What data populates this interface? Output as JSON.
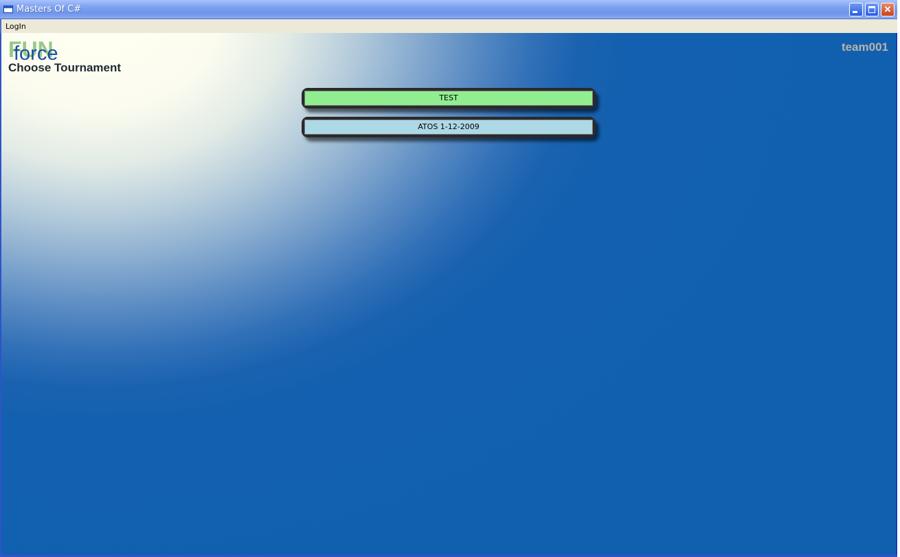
{
  "window": {
    "title": "Masters Of C#",
    "controls": {
      "minimize_icon": "minimize-icon",
      "maximize_icon": "maximize-icon",
      "close_icon": "close-icon",
      "close_glyph": "✕"
    }
  },
  "menu": {
    "items": [
      {
        "label": "LogIn"
      }
    ]
  },
  "header": {
    "logo": {
      "part1": "FUN",
      "part2": "force"
    },
    "page_title": "Choose Tournament",
    "team": "team001"
  },
  "tournaments": [
    {
      "label": "TEST",
      "color": "#90ee90"
    },
    {
      "label": "ATOS 1-12-2009",
      "color": "#add8e6"
    }
  ],
  "colors": {
    "background_blue": "#1160b0",
    "highlight": "#fffff2",
    "team_text": "#b8b4a8"
  }
}
